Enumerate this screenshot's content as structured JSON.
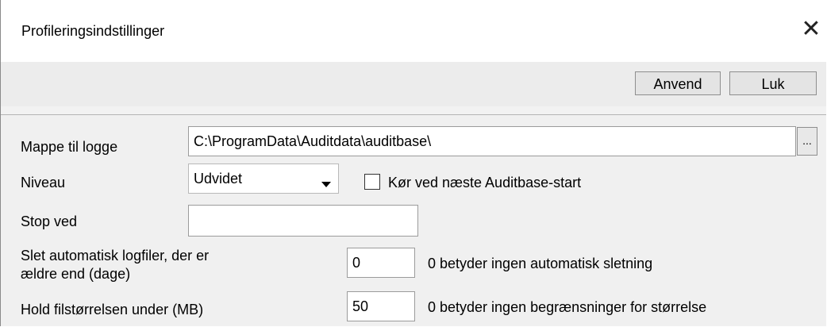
{
  "window": {
    "title": "Profileringsindstillinger",
    "close_glyph": "✕"
  },
  "toolbar": {
    "apply_label": "Anvend",
    "close_label": "Luk"
  },
  "form": {
    "folder": {
      "label": "Mappe til logge",
      "value": "C:\\ProgramData\\Auditdata\\auditbase\\",
      "browse_label": "..."
    },
    "level": {
      "label": "Niveau",
      "value": "Udvidet",
      "run_next_start_label": "Kør ved næste Auditbase-start",
      "run_next_start_checked": false
    },
    "stop_at": {
      "label": "Stop ved",
      "value": ""
    },
    "auto_delete": {
      "label_line1": "Slet automatisk logfiler, der er",
      "label_line2": "ældre end (dage)",
      "value": "0",
      "hint": "0 betyder ingen automatisk sletning"
    },
    "max_size": {
      "label": "Hold filstørrelsen under (MB)",
      "value": "50",
      "hint": "0 betyder ingen begrænsninger for størrelse"
    }
  },
  "icons": {
    "close": "close-icon",
    "dropdown": "chevron-down-icon"
  }
}
